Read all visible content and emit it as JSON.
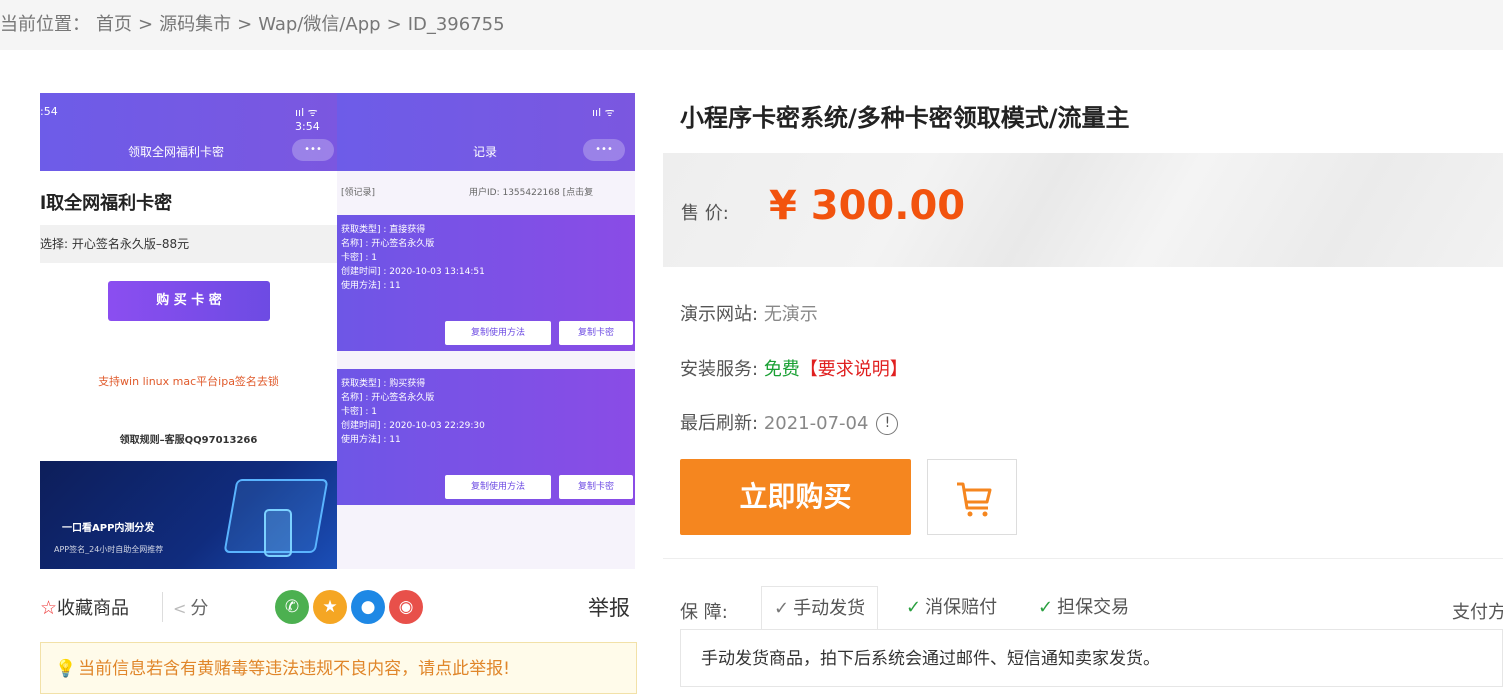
{
  "breadcrumb": {
    "prefix": "当前位置：",
    "items": [
      "首页",
      "源码集市",
      "Wap/微信/App",
      "ID_396755"
    ],
    "separator": ">"
  },
  "gallery": {
    "phone_a": {
      "time": ":54",
      "signal": "ııl ᯤ 3:54",
      "nav_title": "领取全网福利卡密",
      "menu": "•••",
      "heading": "l取全网福利卡密",
      "select": "选择: 开心签名永久版–88元",
      "buy_button": "购 买 卡 密",
      "red_note": "支持win linux mac平台ipa签名去锁",
      "contact": "领取规则–客服QQ97013266",
      "banner_title": "一口看APP内测分发",
      "banner_sub": "APP签名_24小时自助全网推荐"
    },
    "phone_b": {
      "signal": "ııl ᯤ",
      "nav_title": "记录",
      "menu": "•••",
      "head_left": "[领记录]",
      "head_right": "用户ID: 1355422168 [点击复",
      "cards": [
        {
          "lines": [
            "获取类型] : 直接获得",
            "名称] : 开心签名永久版",
            "卡密] : 1",
            "创建时间] : 2020-10-03 13:14:51",
            "使用方法] : 11"
          ],
          "btn_method": "复制使用方法",
          "btn_card": "复制卡密"
        },
        {
          "lines": [
            "获取类型] : 购买获得",
            "名称] : 开心签名永久版",
            "卡密] : 1",
            "创建时间] : 2020-10-03 22:29:30",
            "使用方法] : 11"
          ],
          "btn_method": "复制使用方法",
          "btn_card": "复制卡密"
        }
      ]
    }
  },
  "actions": {
    "favorite": "收藏商品",
    "share": "分",
    "report": "举报",
    "social_icons": [
      "wechat-icon",
      "qzone-icon",
      "qq-icon",
      "weibo-icon"
    ],
    "social_colors": [
      "#4cb050",
      "#f5a623",
      "#1e88e5",
      "#e8504a"
    ]
  },
  "warning": "当前信息若含有黄赌毒等违法违规不良内容，请点此举报!",
  "product": {
    "title": "小程序卡密系统/多种卡密领取模式/流量主",
    "price_label": "售 价:",
    "price": "¥ 300.00",
    "demo_label": "演示网站:",
    "demo_value": "无演示",
    "install_label": "安装服务:",
    "install_value": "免费",
    "install_link": "【要求说明】",
    "refresh_label": "最后刷新:",
    "refresh_value": "2021-07-04",
    "buy_now": "立即购买",
    "accent_color": "#f5861f",
    "price_color": "#f2530e"
  },
  "guarantee": {
    "label": "保 障:",
    "tabs": [
      "手动发货",
      "消保赔付",
      "担保交易"
    ],
    "pay_label": "支付方",
    "description": "手动发货商品，拍下后系统会通过邮件、短信通知卖家发货。"
  }
}
